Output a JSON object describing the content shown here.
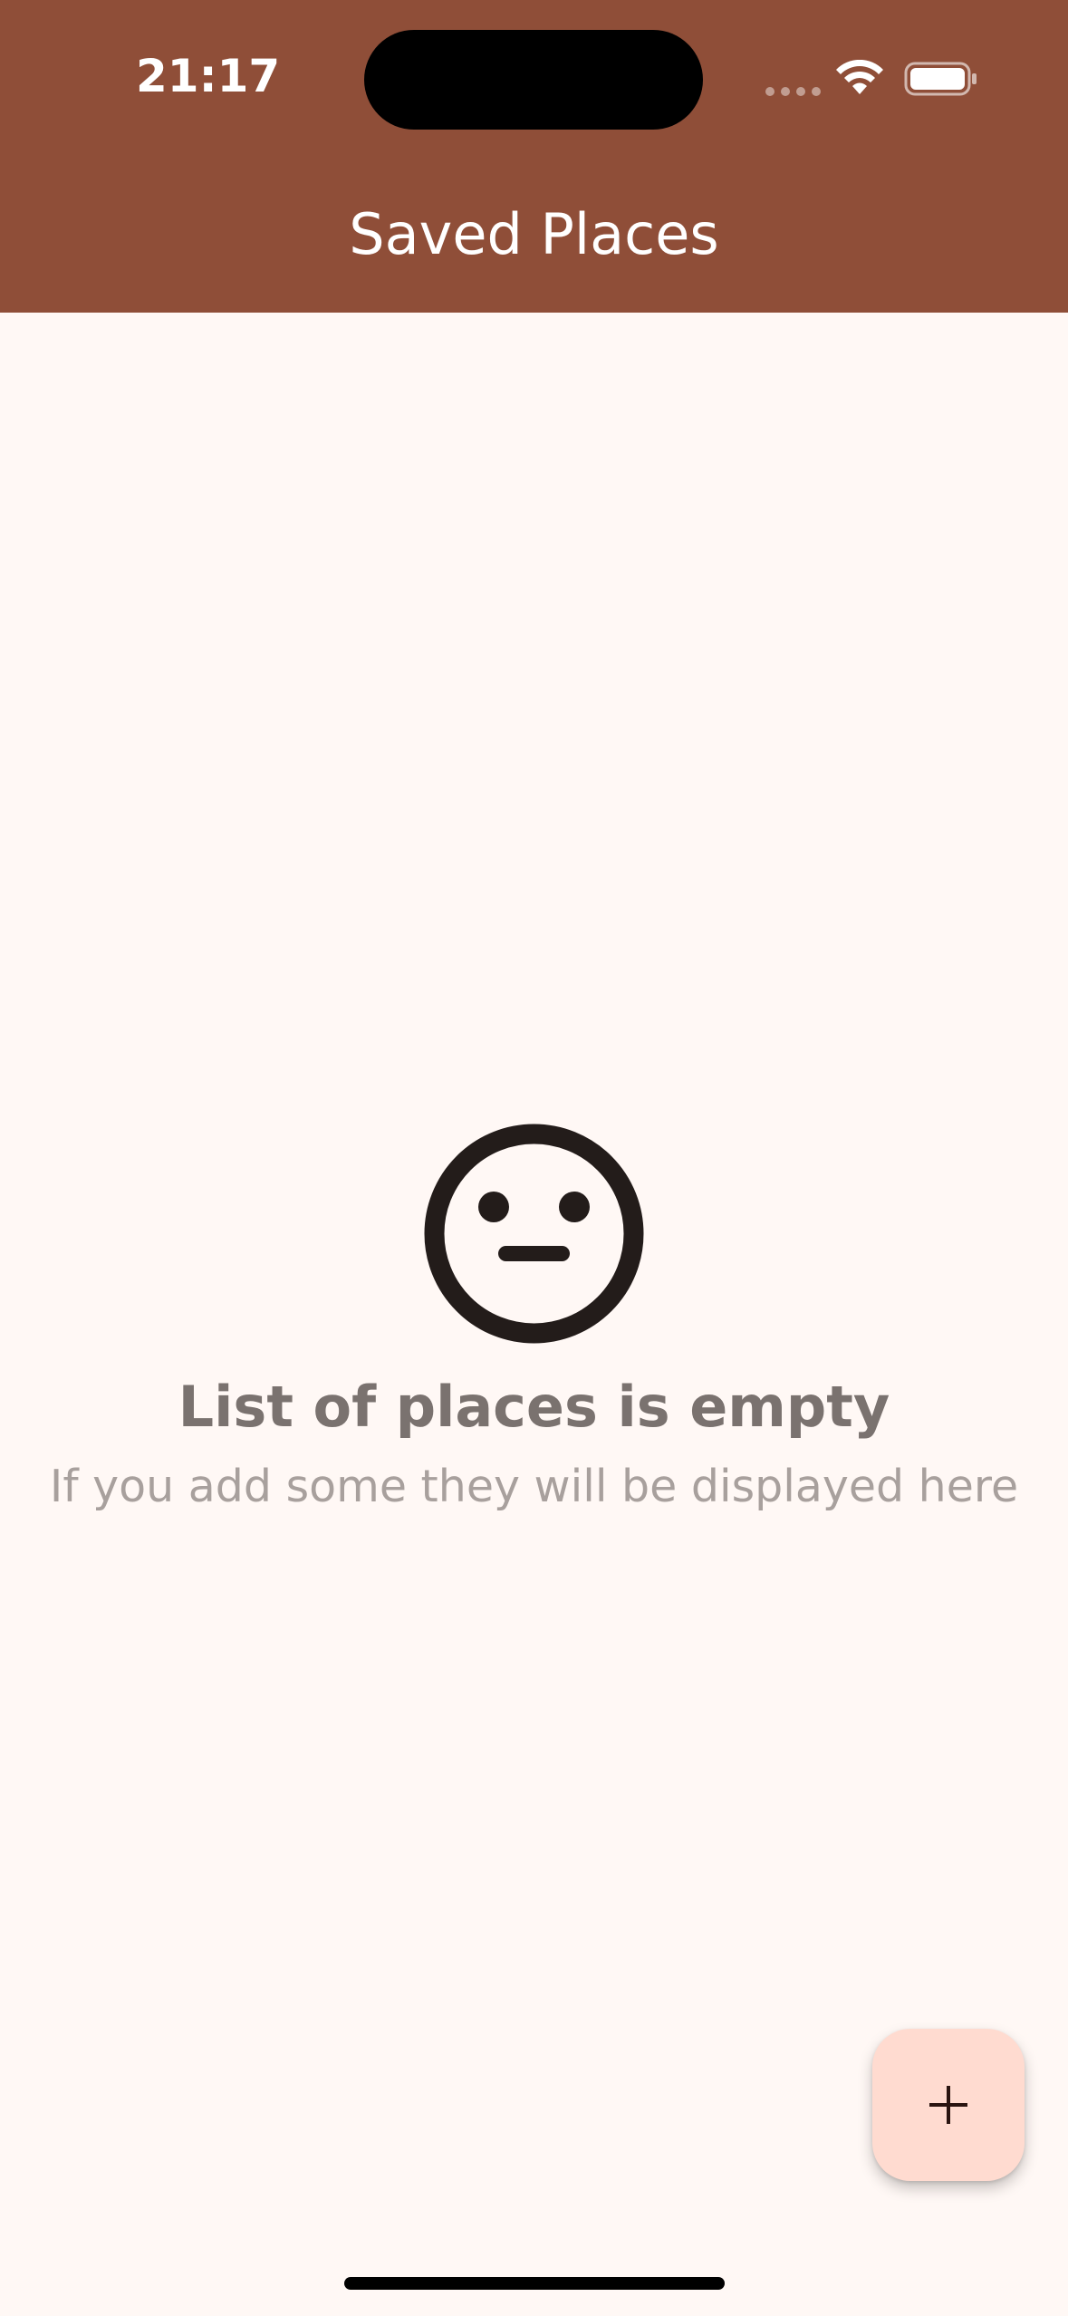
{
  "status_bar": {
    "time": "21:17"
  },
  "header": {
    "title": "Saved Places",
    "background_color": "#8F4E38"
  },
  "empty_state": {
    "icon": "neutral-face-icon",
    "title": "List of places is empty",
    "subtitle": "If you add some they will be displayed here"
  },
  "fab": {
    "icon": "plus-icon",
    "background_color": "#FFDBD0"
  },
  "colors": {
    "background": "#FFF8F5",
    "accent": "#8F4E38"
  }
}
